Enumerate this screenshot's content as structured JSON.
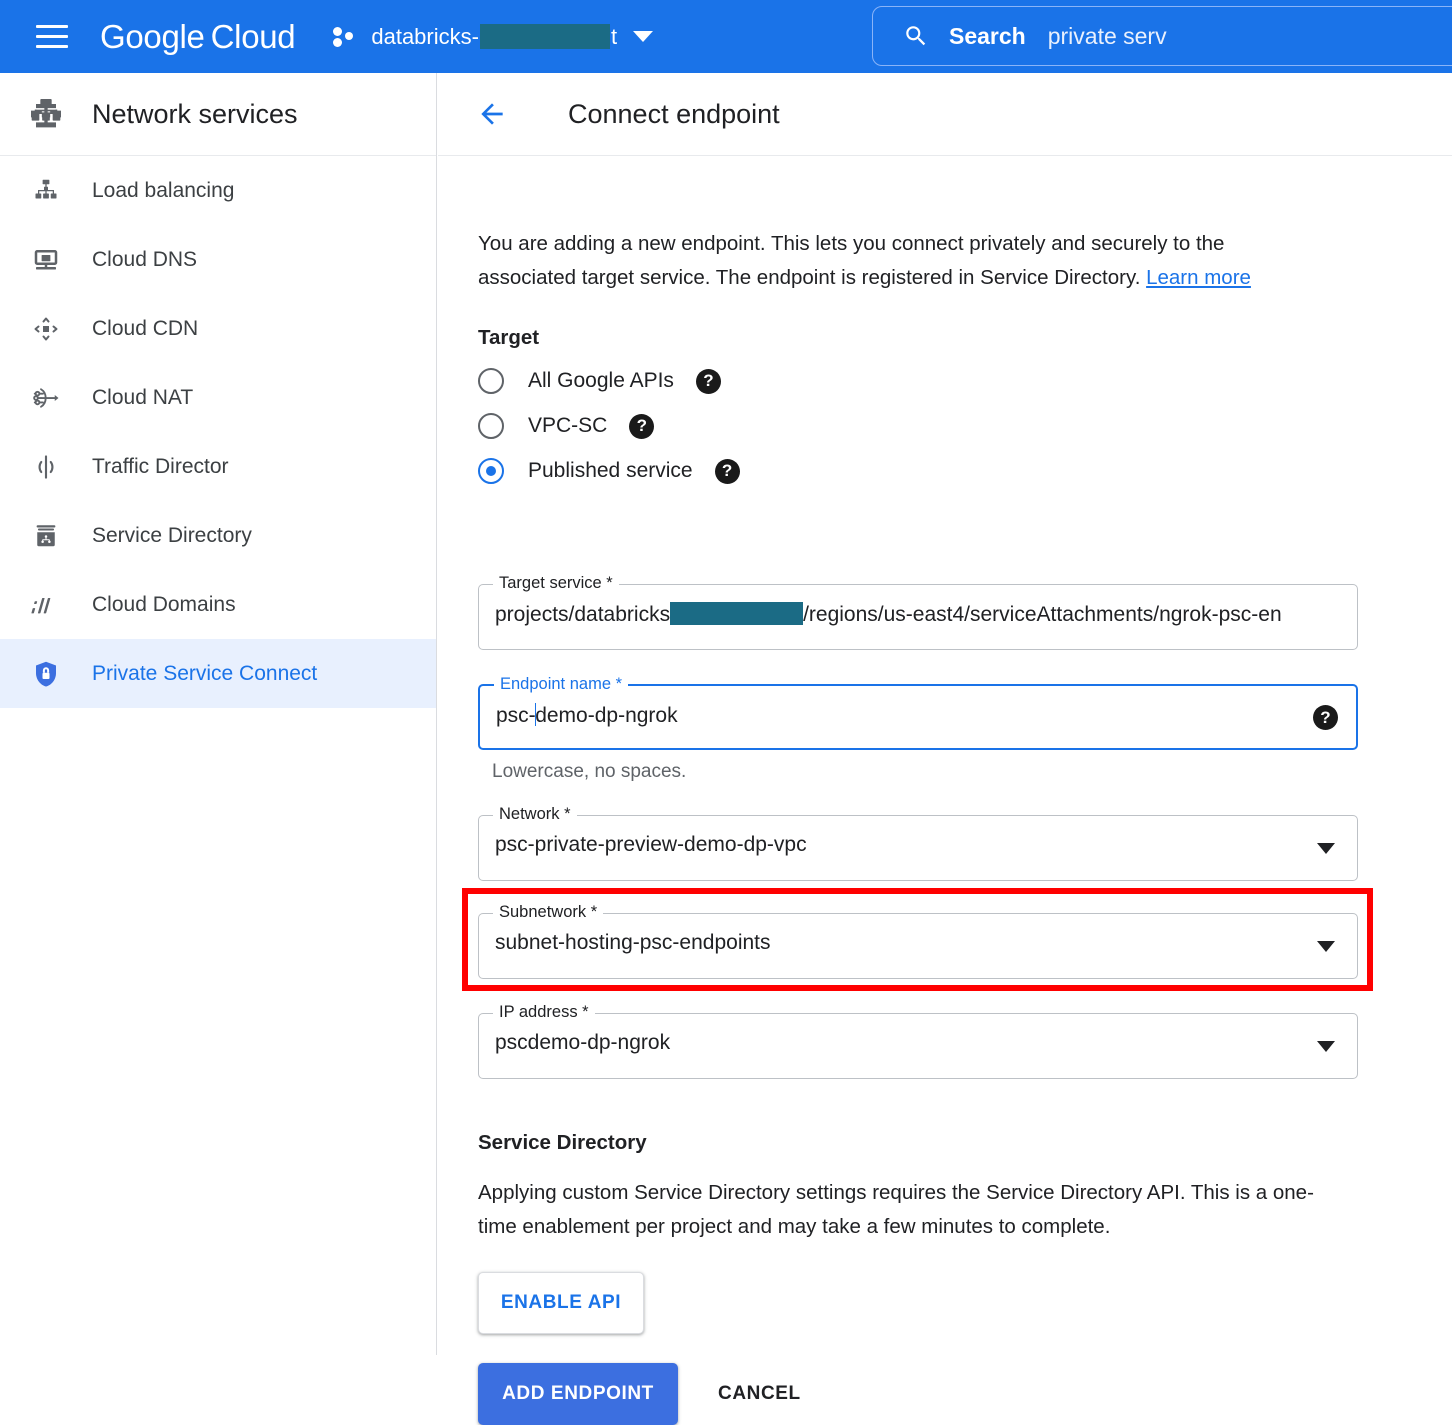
{
  "topbar": {
    "menu_icon": "hamburger-icon",
    "brand_primary": "Google",
    "brand_secondary": "Cloud",
    "project_prefix": "databricks-",
    "project_suffix": "t",
    "project_caret": "chevron-down-icon",
    "search": {
      "icon": "search-icon",
      "label": "Search",
      "query": "private serv"
    },
    "accent_color": "#1a73e8"
  },
  "sidebar": {
    "icon": "network-services-icon",
    "title": "Network services",
    "items": [
      {
        "label": "Load balancing",
        "icon": "load-balancing-icon",
        "selected": false
      },
      {
        "label": "Cloud DNS",
        "icon": "cloud-dns-icon",
        "selected": false
      },
      {
        "label": "Cloud CDN",
        "icon": "cloud-cdn-icon",
        "selected": false
      },
      {
        "label": "Cloud NAT",
        "icon": "cloud-nat-icon",
        "selected": false
      },
      {
        "label": "Traffic Director",
        "icon": "traffic-director-icon",
        "selected": false
      },
      {
        "label": "Service Directory",
        "icon": "service-directory-icon",
        "selected": false
      },
      {
        "label": "Cloud Domains",
        "icon": "cloud-domains-icon",
        "selected": false
      },
      {
        "label": "Private Service Connect",
        "icon": "shield-lock-icon",
        "selected": true
      }
    ],
    "selected_color": "#1a73e8",
    "selected_bg": "#e8f0fe"
  },
  "main": {
    "back_icon": "back-arrow-icon",
    "title": "Connect endpoint",
    "intro_text": "You are adding a new endpoint. This lets you connect privately and securely to the associated target service. The endpoint is registered in Service Directory. ",
    "intro_link": "Learn more",
    "target": {
      "heading": "Target",
      "options": [
        {
          "label": "All Google APIs",
          "selected": false,
          "help": "help-icon"
        },
        {
          "label": "VPC-SC",
          "selected": false,
          "help": "help-icon"
        },
        {
          "label": "Published service",
          "selected": true,
          "help": "help-icon"
        }
      ]
    },
    "fields": {
      "target_service": {
        "label": "Target service *",
        "value_prefix": "projects/databricks",
        "value_suffix": "/regions/us-east4/serviceAttachments/ngrok-psc-en",
        "redacted": true,
        "type": "text"
      },
      "endpoint_name": {
        "label": "Endpoint name  *",
        "value_before_caret": "psc-",
        "value_after_caret": "demo-dp-ngrok",
        "focused": true,
        "help": "help-icon",
        "hint": "Lowercase, no spaces.",
        "type": "text"
      },
      "network": {
        "label": "Network *",
        "value": "psc-private-preview-demo-dp-vpc",
        "type": "select",
        "caret": "dropdown-caret-icon"
      },
      "subnetwork": {
        "label": "Subnetwork *",
        "value": "subnet-hosting-psc-endpoints",
        "type": "select",
        "caret": "dropdown-caret-icon",
        "highlighted": true,
        "highlight_color": "#ff0000"
      },
      "ip_address": {
        "label": "IP address *",
        "value": "pscdemo-dp-ngrok",
        "type": "select",
        "caret": "dropdown-caret-icon"
      }
    },
    "service_directory": {
      "heading": "Service Directory",
      "description": "Applying custom Service Directory settings requires the Service Directory API. This is a one-time enablement per project and may take a few minutes to complete.",
      "enable_button": "ENABLE API"
    },
    "actions": {
      "primary": "ADD ENDPOINT",
      "secondary": "CANCEL"
    }
  }
}
